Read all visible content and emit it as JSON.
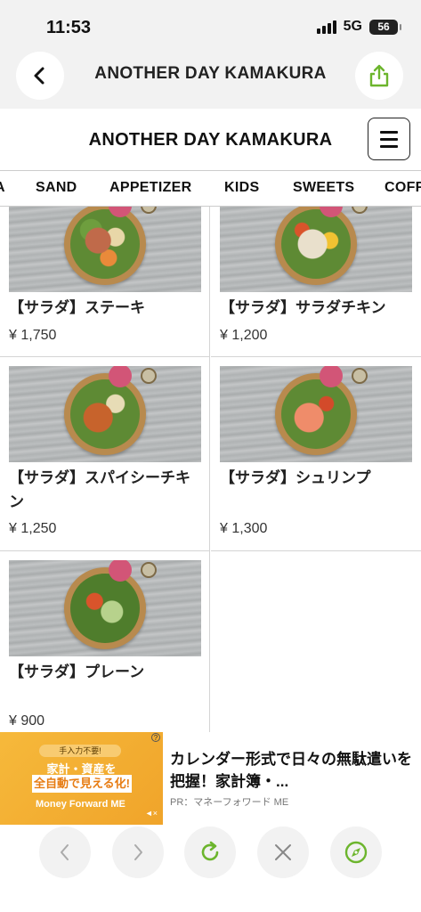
{
  "status": {
    "time": "11:53",
    "network": "5G",
    "battery": "56"
  },
  "browser": {
    "title": "ANOTHER DAY KAMAKURA"
  },
  "site": {
    "title": "ANOTHER DAY KAMAKURA"
  },
  "tabs": [
    "A",
    "SAND",
    "APPETIZER",
    "KIDS",
    "SWEETS",
    "COFF"
  ],
  "menu": [
    {
      "name": "【サラダ】ステーキ",
      "price": "¥ 1,750"
    },
    {
      "name": "【サラダ】サラダチキン",
      "price": "¥ 1,200"
    },
    {
      "name": "【サラダ】スパイシーチキン",
      "price": "¥ 1,250"
    },
    {
      "name": "【サラダ】シュリンプ",
      "price": "¥ 1,300"
    },
    {
      "name": "【サラダ】プレーン",
      "price": "¥ 900"
    }
  ],
  "ad": {
    "tag": "手入力不要!",
    "headline": "家計・資産を",
    "box_text": "全自動で見える化!",
    "brand": "Money Forward ME",
    "info": "?",
    "mute": "◄×",
    "text": "カレンダー形式で日々の無駄遣いを把握！家計簿・...",
    "sponsor": "PR：マネーフォワード ME"
  },
  "icons": {
    "back": "chevron-left-icon",
    "share": "share-icon",
    "menu": "hamburger-menu-icon",
    "toolbar": [
      "chevron-left-icon",
      "chevron-right-icon",
      "reload-icon",
      "close-icon",
      "compass-icon"
    ]
  },
  "colors": {
    "accent_green": "#6cb52d",
    "ad_orange": "#f0a42a"
  }
}
